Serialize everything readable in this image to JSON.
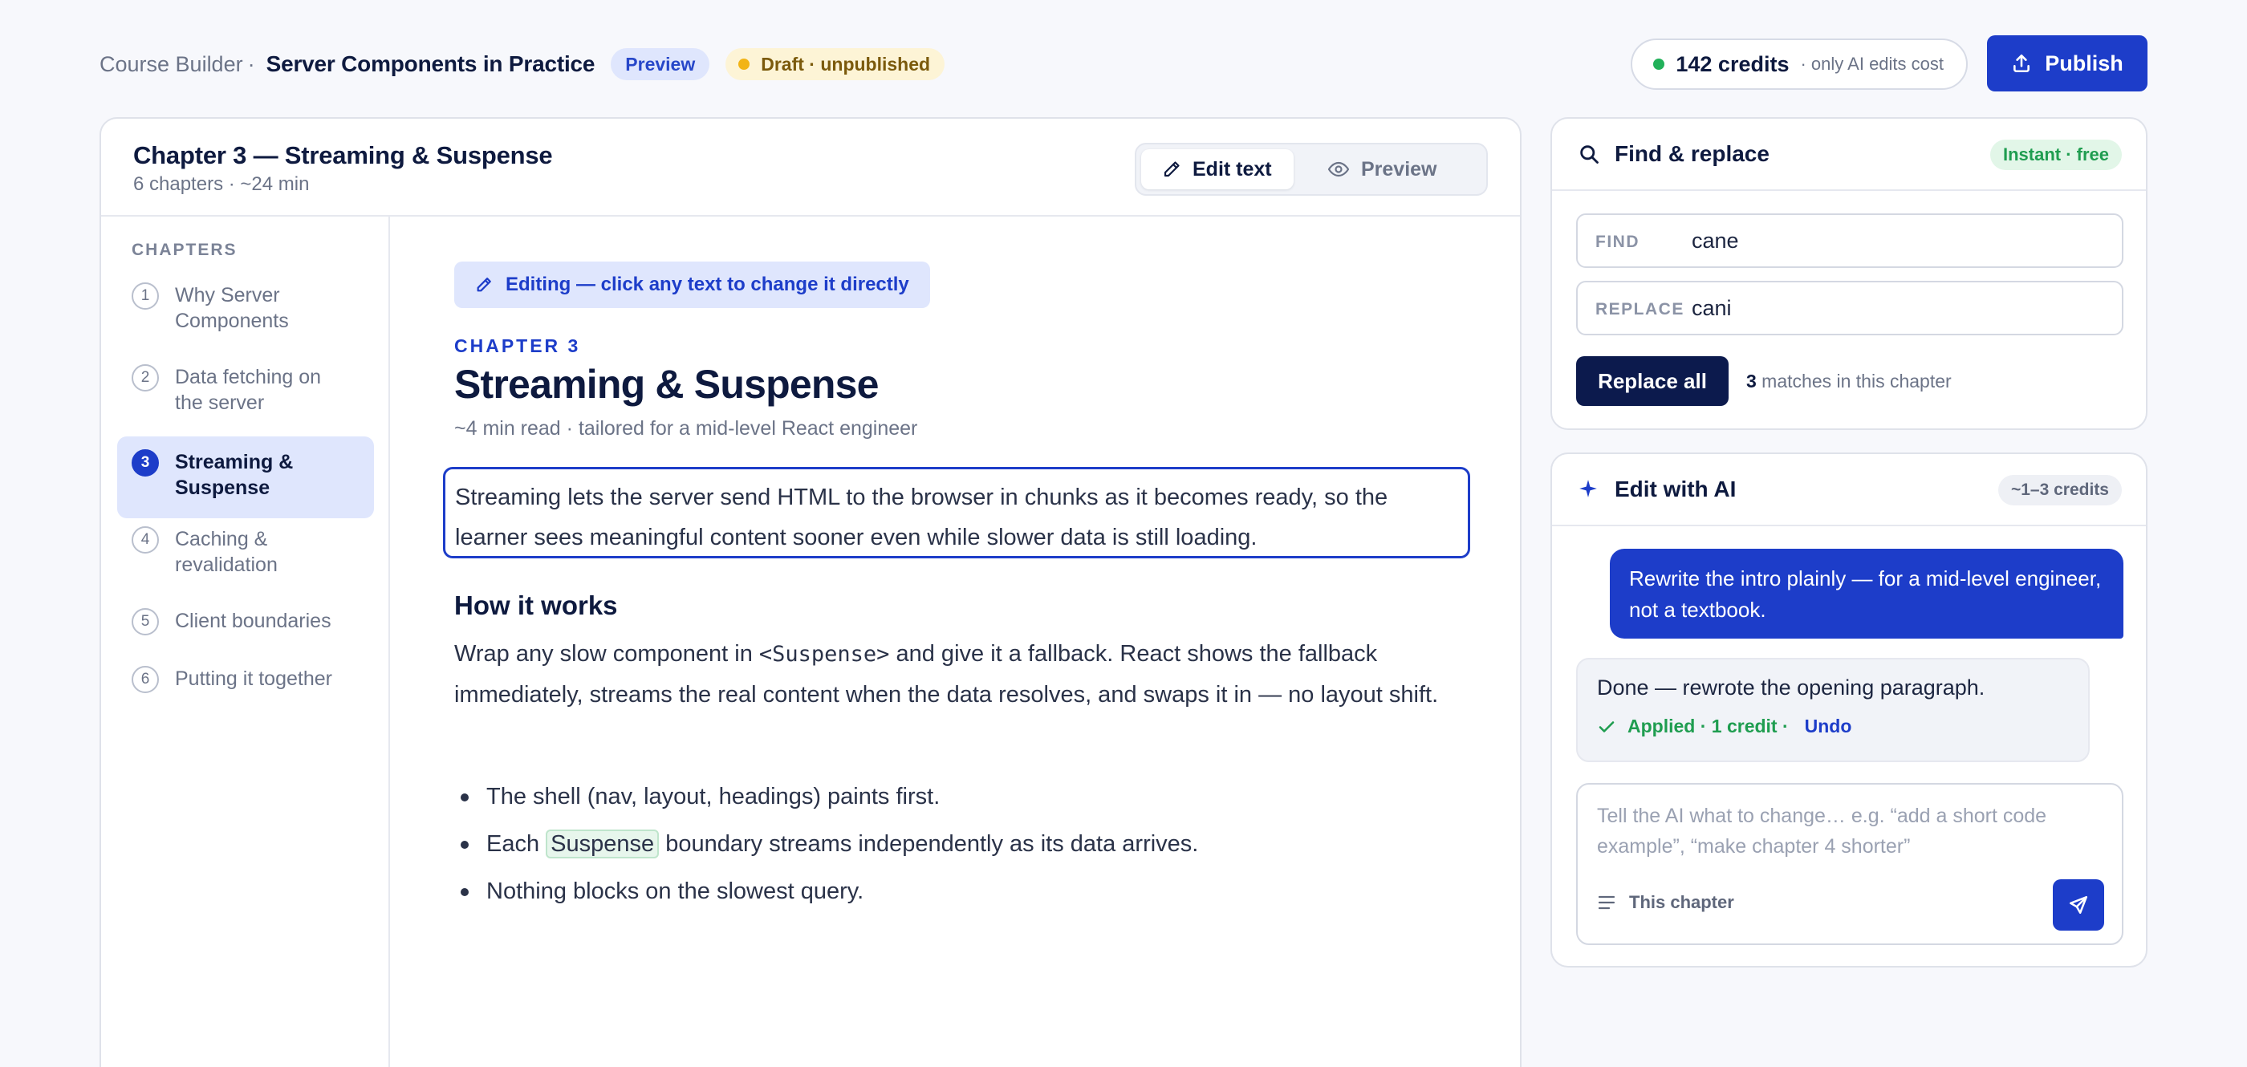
{
  "header": {
    "breadcrumb_root": "Course Builder",
    "breadcrumb_sep": "·",
    "course_title": "Server Components in Practice",
    "preview_badge": "Preview",
    "draft_badge": "Draft · unpublished",
    "credits_value": "142 credits",
    "credits_note": "· only AI edits cost",
    "publish_label": "Publish"
  },
  "editor": {
    "chapter_title": "Chapter 3 — Streaming & Suspense",
    "chapter_meta": "6 chapters · ~24 min",
    "mode_edit": "Edit text",
    "mode_preview": "Preview"
  },
  "sidebar": {
    "heading": "CHAPTERS",
    "items": [
      {
        "num": "1",
        "label": "Why Server Components"
      },
      {
        "num": "2",
        "label": "Data fetching on the server"
      },
      {
        "num": "3",
        "label": "Streaming & Suspense",
        "active": true
      },
      {
        "num": "4",
        "label": "Caching & revalidation"
      },
      {
        "num": "5",
        "label": "Client boundaries"
      },
      {
        "num": "6",
        "label": "Putting it together"
      }
    ]
  },
  "content": {
    "edit_hint": "Editing — click any text to change it directly",
    "kicker": "CHAPTER 3",
    "heading": "Streaming & Suspense",
    "meta": "~4 min read · tailored for a mid-level React engineer",
    "intro": "Streaming lets the server send HTML to the browser in chunks as it becomes ready, so the learner sees meaningful content sooner  even while slower data is still loading.",
    "subheading": "How it works",
    "para_before": "Wrap any slow component in ",
    "para_code": "<Suspense>",
    "para_after": " and give it a fallback. React shows the fallback immediately, streams the real content when the data resolves, and swaps it in — no layout shift.",
    "bullet_1": "The shell (nav, layout, headings) paints first.",
    "bullet_2_before": "Each ",
    "bullet_2_highlight": "Suspense",
    "bullet_2_after": " boundary streams independently as its data arrives.",
    "bullet_3": "Nothing blocks on the slowest query."
  },
  "find_replace": {
    "title": "Find & replace",
    "tag": "Instant · free",
    "find_label": "FIND",
    "find_value": "cane",
    "replace_label": "REPLACE",
    "replace_value": "cani",
    "button": "Replace all",
    "match_count": "3",
    "match_text": " matches in this chapter"
  },
  "ai": {
    "title": "Edit with AI",
    "cost_tag": "~1–3 credits",
    "user_message": "Rewrite the intro plainly — for a mid-level engineer, not a textbook.",
    "reply": "Done — rewrote the opening paragraph.",
    "status": "Applied · 1 credit ·",
    "undo": "Undo",
    "placeholder": "Tell the AI what to change… e.g. “add a short code example”, “make chapter 4 shorter”",
    "scope": "This chapter"
  },
  "colors": {
    "accent": "#1d3dc9",
    "navy": "#0c1a4d",
    "success": "#1f9d50",
    "warning_dot": "#f2b416"
  }
}
